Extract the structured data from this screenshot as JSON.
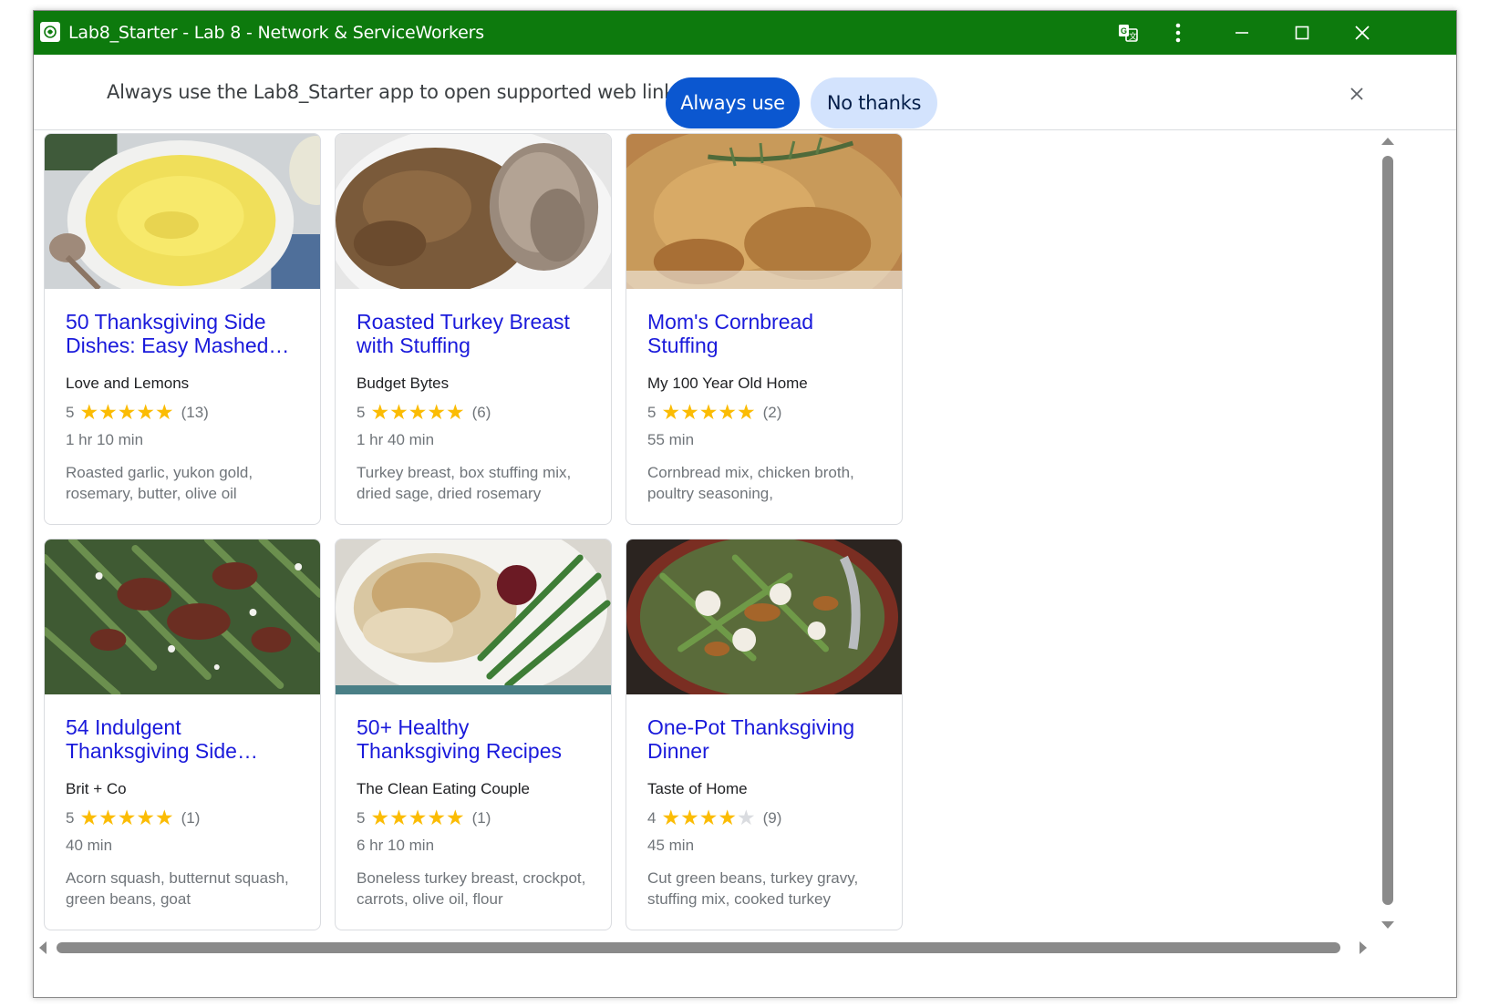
{
  "window": {
    "title": "Lab8_Starter - Lab 8 - Network & ServiceWorkers",
    "titlebar_color": "#0d7a0d",
    "controls": [
      "translate-icon",
      "more-vert-icon",
      "minimize-icon",
      "maximize-icon",
      "close-icon"
    ]
  },
  "infobar": {
    "message": "Always use the Lab8_Starter app to open supported web links?",
    "always_label": "Always use",
    "no_thanks_label": "No thanks"
  },
  "colors": {
    "link": "#1a1adb",
    "star": "#fbbc04",
    "primary_button": "#0b57d0",
    "secondary_button": "#d3e3fd"
  },
  "recipes": [
    {
      "title": "50 Thanksgiving Side Dishes: Easy Mashed…",
      "organization": "Love and Lemons",
      "rating": "5",
      "stars": 5,
      "reviews": "(13)",
      "time": "1 hr 10 min",
      "ingredients": "Roasted garlic, yukon gold, rosemary, butter, olive oil",
      "image": "mashed-potatoes-photo"
    },
    {
      "title": "Roasted Turkey Breast with Stuffing",
      "organization": "Budget Bytes",
      "rating": "5",
      "stars": 5,
      "reviews": "(6)",
      "time": "1 hr 40 min",
      "ingredients": "Turkey breast, box stuffing mix, dried sage, dried rosemary",
      "image": "turkey-stuffing-photo"
    },
    {
      "title": "Mom's Cornbread Stuffing",
      "organization": "My 100 Year Old Home",
      "rating": "5",
      "stars": 5,
      "reviews": "(2)",
      "time": "55 min",
      "ingredients": "Cornbread mix, chicken broth, poultry seasoning,",
      "image": "cornbread-stuffing-photo"
    },
    {
      "title": "54 Indulgent Thanksgiving Side…",
      "organization": "Brit + Co",
      "rating": "5",
      "stars": 5,
      "reviews": "(1)",
      "time": "40 min",
      "ingredients": "Acorn squash, butternut squash, green beans, goat",
      "image": "green-beans-pecans-photo"
    },
    {
      "title": "50+ Healthy Thanksgiving Recipes",
      "organization": "The Clean Eating Couple",
      "rating": "5",
      "stars": 5,
      "reviews": "(1)",
      "time": "6 hr 10 min",
      "ingredients": "Boneless turkey breast, crockpot, carrots, olive oil, flour",
      "image": "turkey-gravy-plate-photo"
    },
    {
      "title": "One-Pot Thanksgiving Dinner",
      "organization": "Taste of Home",
      "rating": "4",
      "stars": 4,
      "reviews": "(9)",
      "time": "45 min",
      "ingredients": "Cut green beans, turkey gravy, stuffing mix, cooked turkey",
      "image": "one-pot-dinner-photo"
    }
  ]
}
